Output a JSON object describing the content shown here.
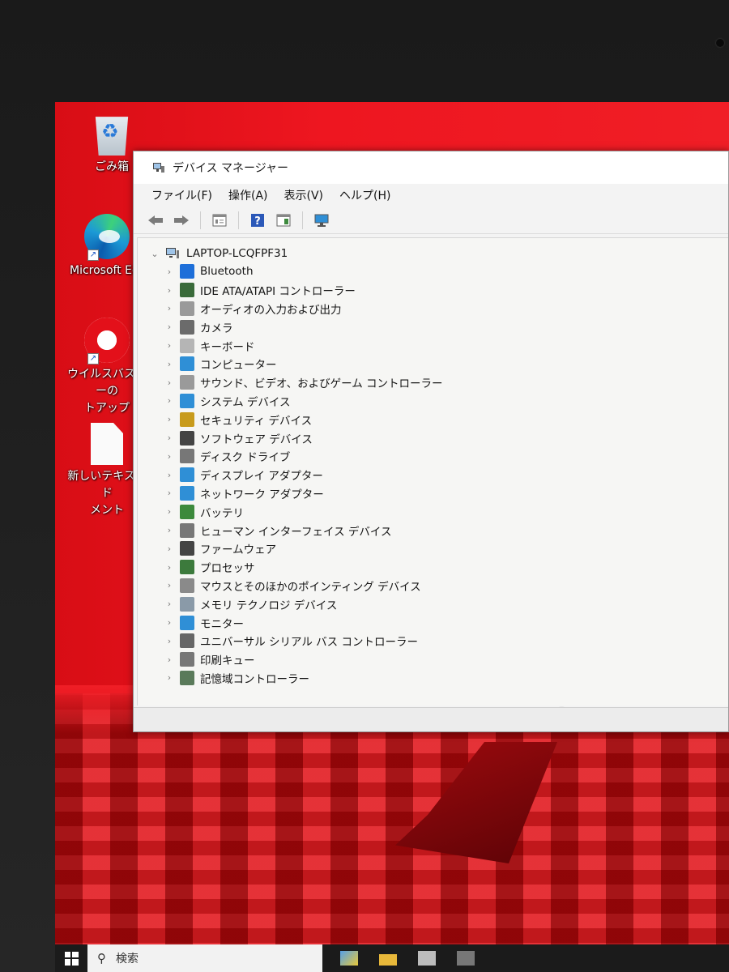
{
  "desktop": {
    "icons": [
      {
        "label": "ごみ箱",
        "icon": "recycle-bin-icon"
      },
      {
        "label": "Microsoft Ed",
        "icon": "edge-icon"
      },
      {
        "label": "ウイルスバスターの\nトアップ",
        "icon": "trend-micro-icon"
      },
      {
        "label": "新しいテキスト ド\nメント",
        "icon": "text-document-icon"
      }
    ]
  },
  "window": {
    "title": "デバイス マネージャー",
    "menu": [
      "ファイル(F)",
      "操作(A)",
      "表示(V)",
      "ヘルプ(H)"
    ],
    "toolbar": [
      "back-arrow-icon",
      "forward-arrow-icon",
      "properties-icon",
      "help-icon",
      "view-icon",
      "monitor-icon"
    ],
    "root": "LAPTOP-LCQFPF31",
    "categories": [
      {
        "label": "Bluetooth",
        "icon": "bluetooth-icon",
        "color": "#1e6fd9"
      },
      {
        "label": "IDE ATA/ATAPI コントローラー",
        "icon": "ide-controller-icon",
        "color": "#3a6b3a"
      },
      {
        "label": "オーディオの入力および出力",
        "icon": "speaker-icon",
        "color": "#9a9a9a"
      },
      {
        "label": "カメラ",
        "icon": "camera-icon",
        "color": "#6b6b6b"
      },
      {
        "label": "キーボード",
        "icon": "keyboard-icon",
        "color": "#b5b5b5"
      },
      {
        "label": "コンピューター",
        "icon": "computer-icon",
        "color": "#2f8fd6"
      },
      {
        "label": "サウンド、ビデオ、およびゲーム コントローラー",
        "icon": "sound-icon",
        "color": "#9a9a9a"
      },
      {
        "label": "システム デバイス",
        "icon": "system-device-icon",
        "color": "#2f8fd6"
      },
      {
        "label": "セキュリティ デバイス",
        "icon": "security-key-icon",
        "color": "#c89b1c"
      },
      {
        "label": "ソフトウェア デバイス",
        "icon": "software-device-icon",
        "color": "#444444"
      },
      {
        "label": "ディスク ドライブ",
        "icon": "disk-drive-icon",
        "color": "#777777"
      },
      {
        "label": "ディスプレイ アダプター",
        "icon": "display-adapter-icon",
        "color": "#2f8fd6"
      },
      {
        "label": "ネットワーク アダプター",
        "icon": "network-adapter-icon",
        "color": "#2f8fd6"
      },
      {
        "label": "バッテリ",
        "icon": "battery-icon",
        "color": "#3c8a3c"
      },
      {
        "label": "ヒューマン インターフェイス デバイス",
        "icon": "hid-icon",
        "color": "#777777"
      },
      {
        "label": "ファームウェア",
        "icon": "firmware-icon",
        "color": "#444444"
      },
      {
        "label": "プロセッサ",
        "icon": "processor-icon",
        "color": "#3c7a3c"
      },
      {
        "label": "マウスとそのほかのポインティング デバイス",
        "icon": "mouse-icon",
        "color": "#8a8a8a"
      },
      {
        "label": "メモリ テクノロジ デバイス",
        "icon": "memory-icon",
        "color": "#8a9aa8"
      },
      {
        "label": "モニター",
        "icon": "monitor-icon",
        "color": "#2f8fd6"
      },
      {
        "label": "ユニバーサル シリアル バス コントローラー",
        "icon": "usb-icon",
        "color": "#666666"
      },
      {
        "label": "印刷キュー",
        "icon": "printer-icon",
        "color": "#777777"
      },
      {
        "label": "記憶域コントローラー",
        "icon": "storage-controller-icon",
        "color": "#5a7a5a"
      }
    ]
  },
  "taskbar": {
    "search_placeholder": "検索"
  }
}
